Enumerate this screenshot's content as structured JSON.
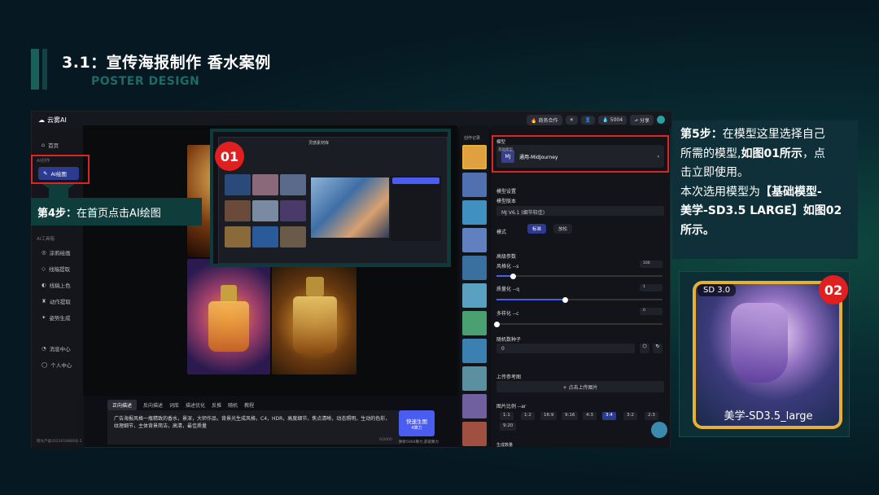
{
  "slide": {
    "title": "3.1：宣传海报制作  香水案例",
    "subtitle": "POSTER DESIGN"
  },
  "app": {
    "brand": "云雾AI",
    "top_pills": [
      "🔥 商务合作",
      "☀",
      "👤",
      "💧 5004",
      "⬏ 分享"
    ],
    "sidebar": {
      "home": "首页",
      "group1": "AI创作",
      "ai_draw": "AI绘图",
      "group2": "AI工具箱",
      "items": [
        "涂鸦绘画",
        "线稿提取",
        "线稿上色",
        "动作提取",
        "姿势生成"
      ],
      "msg": "消息中心",
      "me": "个人中心",
      "footer": "网文产备2023018880号-2"
    },
    "popup": {
      "title": "灵感素材库"
    },
    "prompt": {
      "tabs": [
        "正向描述",
        "反向描述",
        "词库",
        "描述优化",
        "反推",
        "随机",
        "教程"
      ],
      "text": "广告海报风格一瓶精致的香水，景深，大师作品，背景光生成风格，C4，HDR，高度细节，焦点清晰，动态照明，生动的色彩，纹理细节，主体背景简洁，高清，最佳质量",
      "gen_label": "快速生图",
      "gen_sub": "4算力",
      "balance": "剩余5004算力,获取算力",
      "count": "0/2000"
    },
    "thumbs_label": "创作记录",
    "right": {
      "model_label": "模型",
      "model_sub": "基础模型",
      "model_name": "通用-MidJourney",
      "settings": "模型设置",
      "version_label": "模型版本",
      "version": "MJ V6.1 (细节较佳)",
      "mode_label": "模式",
      "mode_fast": "标准",
      "mode_relax": "放松",
      "advanced": "高级参数",
      "stylize": "风格化 --s",
      "stylize_val": "100",
      "quality": "质量化 --q",
      "quality_val": "1",
      "chaos": "多样化 --c",
      "chaos_val": "0",
      "seed": "随机数种子",
      "seed_val": "0",
      "ref": "上传参考图",
      "upload": "+ 点击上传图片",
      "ratio_label": "图片比例 --ar",
      "ratios": [
        "1:1",
        "1:2",
        "16:9",
        "9:16",
        "4:3",
        "3:4",
        "3:2",
        "2:3",
        "9:20"
      ],
      "more": "生成数量"
    }
  },
  "step4": {
    "bold": "第4步：",
    "text": "在首页点击AI绘图"
  },
  "step5": {
    "l1b": "第5步：",
    "l1": "在模型这里选择自己",
    "l2": "所需的模型,",
    "l2b": "如图01所示",
    "l2c": "，点",
    "l3": "击立即使用。",
    "l4": "本次选用模型为",
    "l4b": "【基础模型-",
    "l5b": "美学-SD3.5 LARGE】",
    "l5": "如图02",
    "l6b": "所示。"
  },
  "badge1": "01",
  "badge2": "02",
  "card": {
    "tag": "SD 3.0",
    "label": "美学-SD3.5_large"
  }
}
